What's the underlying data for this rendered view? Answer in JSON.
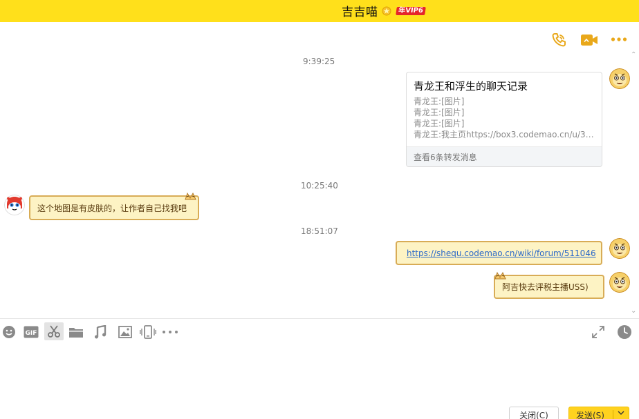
{
  "window": {
    "title": "吉吉喵",
    "vip_badge": "年VIP6"
  },
  "colors": {
    "titlebar": "#ffe01b",
    "accent_icon": "#e9a81a",
    "bubble_fill": "#fdf3c4",
    "bubble_border": "#d8ac56",
    "link": "#2a68c8"
  },
  "header_actions": {
    "call_icon": "phone-icon",
    "video_icon": "video-camera-icon",
    "more_icon": "more-dots-icon"
  },
  "messages": [
    {
      "type": "timestamp",
      "text": "9:39:25"
    },
    {
      "type": "forwarded-card",
      "side": "right",
      "title": "青龙王和浮生的聊天记录",
      "lines": [
        "青龙王:[图片]",
        "青龙王:[图片]",
        "青龙王:[图片]",
        "青龙王:我主页https://box3.codemao.cn/u/3a..."
      ],
      "footer": "查看6条转发消息"
    },
    {
      "type": "timestamp",
      "text": "10:25:40"
    },
    {
      "type": "text",
      "side": "left",
      "text": "这个地图是有皮肤的，让作者自己找我吧"
    },
    {
      "type": "timestamp",
      "text": "18:51:07"
    },
    {
      "type": "link",
      "side": "right",
      "text": "https://shequ.codemao.cn/wiki/forum/511046"
    },
    {
      "type": "text",
      "side": "right",
      "text": "阿吉快去评税主播USS)"
    }
  ],
  "toolbar": {
    "items": [
      "emoji-icon",
      "gif-icon",
      "scissors-icon",
      "folder-icon",
      "music-note-icon",
      "image-icon",
      "screen-shake-icon",
      "more-dots-icon"
    ],
    "gif_label": "GIF",
    "right_items": [
      "expand-icon",
      "history-clock-icon"
    ]
  },
  "buttons": {
    "close_label": "关闭(C)",
    "send_label": "发送(S)"
  }
}
